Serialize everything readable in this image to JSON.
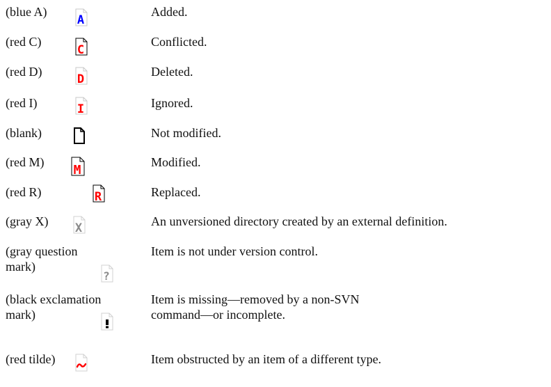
{
  "legend": [
    {
      "label": "(blue A)",
      "desc": "Added.",
      "glyph": "A",
      "color": "#0000ff",
      "icon": "file-added-icon"
    },
    {
      "label": "(red C)",
      "desc": "Conflicted.",
      "glyph": "C",
      "color": "#ff0000",
      "icon": "file-conflicted-icon"
    },
    {
      "label": "(red D)",
      "desc": "Deleted.",
      "glyph": "D",
      "color": "#ff0000",
      "icon": "file-deleted-icon"
    },
    {
      "label": "(red I)",
      "desc": "Ignored.",
      "glyph": "I",
      "color": "#ff0000",
      "icon": "file-ignored-icon"
    },
    {
      "label": "(blank)",
      "desc": "Not modified.",
      "glyph": "",
      "color": "#000000",
      "icon": "file-unmodified-icon"
    },
    {
      "label": "(red M)",
      "desc": "Modified.",
      "glyph": "M",
      "color": "#ff0000",
      "icon": "file-modified-icon"
    },
    {
      "label": "(red R)",
      "desc": "Replaced.",
      "glyph": "R",
      "color": "#ff0000",
      "icon": "file-replaced-icon"
    },
    {
      "label": "(gray X)",
      "desc": "An unversioned directory created by an external definition.",
      "glyph": "X",
      "color": "#8a8a8a",
      "icon": "file-external-icon"
    },
    {
      "label": "(gray question mark)",
      "desc": "Item is not under version control.",
      "glyph": "?",
      "color": "#8a8a8a",
      "icon": "file-unversioned-icon"
    },
    {
      "label": "(black exclamation mark)",
      "desc": "Item is missing—removed by a non-SVN command—or incomplete.",
      "glyph": "!",
      "color": "#000000",
      "icon": "file-missing-icon"
    },
    {
      "label": "(red tilde)",
      "desc": "Item obstructed by an item of a different type.",
      "glyph": "~",
      "color": "#ff0000",
      "icon": "file-obstructed-icon"
    }
  ]
}
